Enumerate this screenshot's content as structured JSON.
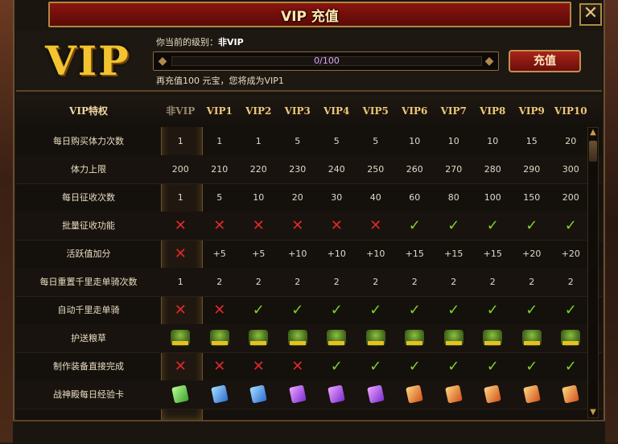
{
  "title": "VIP 充值",
  "close_icon": "close-icon",
  "logo_text": "VIP",
  "current_level_label": "你当前的级别：",
  "current_level_value": "非VIP",
  "progress": {
    "text": "0/100",
    "value": 0,
    "max": 100
  },
  "hint": "再充值100 元宝，您将成为VIP1",
  "recharge_button": "充值",
  "headers": [
    "VIP特权",
    "非VIP",
    "VIP1",
    "VIP2",
    "VIP3",
    "VIP4",
    "VIP5",
    "VIP6",
    "VIP7",
    "VIP8",
    "VIP9",
    "VIP10"
  ],
  "rows": [
    {
      "label": "每日购买体力次数",
      "cells": [
        "1",
        "1",
        "1",
        "5",
        "5",
        "5",
        "10",
        "10",
        "10",
        "15",
        "20"
      ]
    },
    {
      "label": "体力上限",
      "cells": [
        "200",
        "210",
        "220",
        "230",
        "240",
        "250",
        "260",
        "270",
        "280",
        "290",
        "300"
      ]
    },
    {
      "label": "每日征收次数",
      "cells": [
        "1",
        "5",
        "10",
        "20",
        "30",
        "40",
        "60",
        "80",
        "100",
        "150",
        "200"
      ]
    },
    {
      "label": "批量征收功能",
      "cells": [
        "x",
        "x",
        "x",
        "x",
        "x",
        "x",
        "v",
        "v",
        "v",
        "v",
        "v"
      ]
    },
    {
      "label": "活跃值加分",
      "cells": [
        "x",
        "+5",
        "+5",
        "+10",
        "+10",
        "+10",
        "+15",
        "+15",
        "+15",
        "+20",
        "+20"
      ]
    },
    {
      "label": "每日重置千里走单骑次数",
      "cells": [
        "1",
        "2",
        "2",
        "2",
        "2",
        "2",
        "2",
        "2",
        "2",
        "2",
        "2"
      ]
    },
    {
      "label": "自动千里走单骑",
      "cells": [
        "x",
        "x",
        "v",
        "v",
        "v",
        "v",
        "v",
        "v",
        "v",
        "v",
        "v"
      ]
    },
    {
      "label": "护送粮草",
      "cells": [
        "escort",
        "escort",
        "escort",
        "escort",
        "escort",
        "escort",
        "escort",
        "escort",
        "escort",
        "escort",
        "escort"
      ]
    },
    {
      "label": "制作装备直接完成",
      "cells": [
        "x",
        "x",
        "x",
        "x",
        "v",
        "v",
        "v",
        "v",
        "v",
        "v",
        "v"
      ]
    },
    {
      "label": "战神殿每日经验卡",
      "cells": [
        "green",
        "blue",
        "blue",
        "purple",
        "purple",
        "purple",
        "orange",
        "orange",
        "orange",
        "orange",
        "orange"
      ]
    }
  ],
  "colors": {
    "cross": "#e0282a",
    "check": "#7ed22a",
    "accent": "#f0c878"
  }
}
